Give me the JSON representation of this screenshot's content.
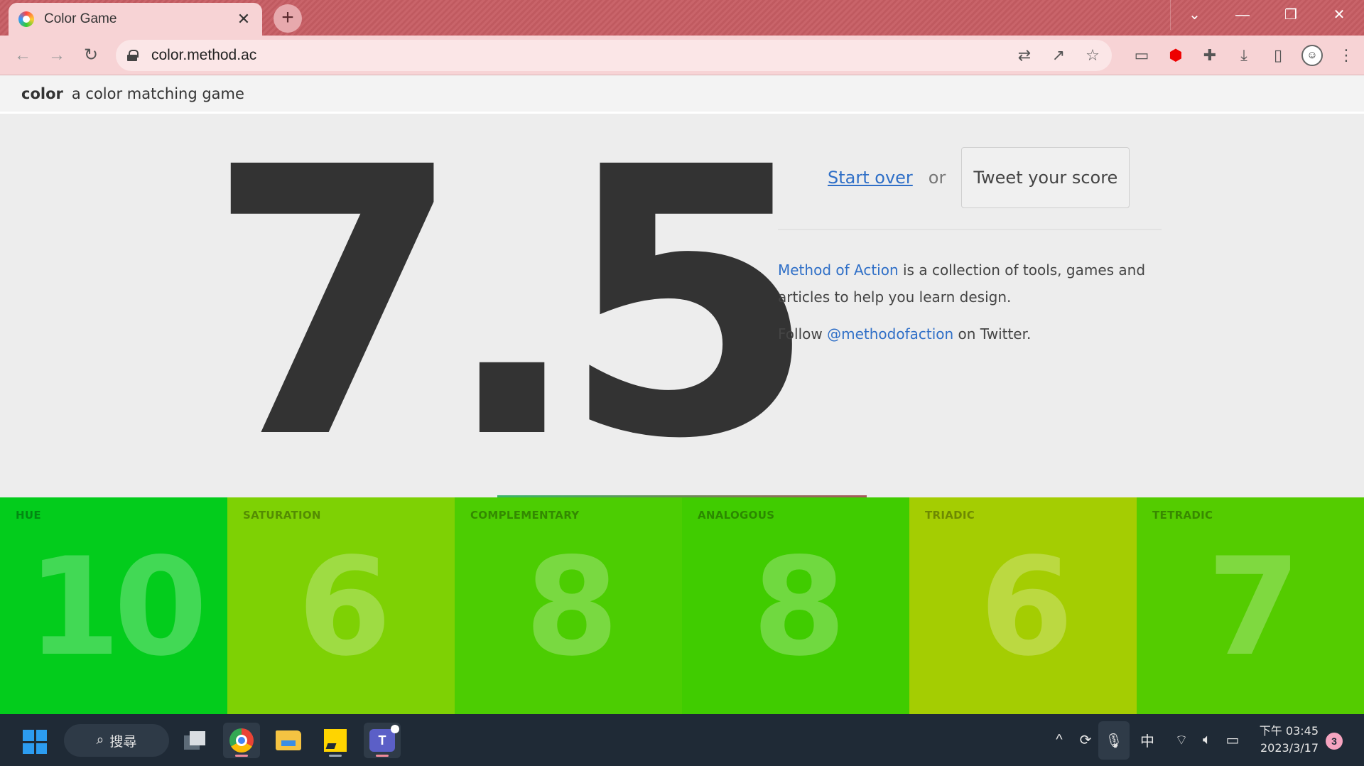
{
  "browser": {
    "tab_title": "Color Game",
    "tab_close": "✕",
    "new_tab": "+",
    "url": "color.method.ac",
    "window_controls": [
      "⌄",
      "—",
      "❐",
      "✕"
    ]
  },
  "site": {
    "brand": "color",
    "tagline": "a color matching game"
  },
  "score": {
    "total": "7.5",
    "start_over": "Start over",
    "or": "or",
    "tweet": "Tweet your score",
    "about_link": "Method of Action",
    "about_rest": " is a collection of tools, games and articles to help you learn design.",
    "follow_prefix": "Follow ",
    "follow_link": "@methodofaction",
    "follow_suffix": " on Twitter."
  },
  "categories": [
    {
      "label": "HUE",
      "score": "10",
      "color": "#03cc1c"
    },
    {
      "label": "SATURATION",
      "score": "6",
      "color": "#7ed104"
    },
    {
      "label": "COMPLEMENTARY",
      "score": "8",
      "color": "#4ccd02"
    },
    {
      "label": "ANALOGOUS",
      "score": "8",
      "color": "#40cc00"
    },
    {
      "label": "TRIADIC",
      "score": "6",
      "color": "#a4cd02"
    },
    {
      "label": "TETRADIC",
      "score": "7",
      "color": "#54cc00"
    }
  ],
  "taskbar": {
    "search_label": "搜尋",
    "ime": "中",
    "time": "下午 03:45",
    "date": "2023/3/17",
    "notifications": "3"
  }
}
